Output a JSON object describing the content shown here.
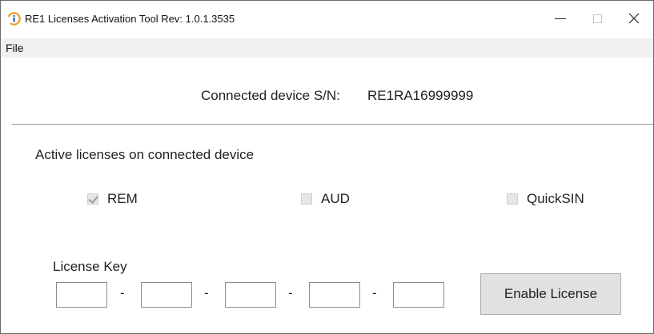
{
  "window": {
    "title": "RE1 Licenses Activation Tool Rev: 1.0.1.3535",
    "controls": {
      "minimize": "—",
      "maximize": "□",
      "close": "✕"
    }
  },
  "menu": {
    "items": [
      "File"
    ]
  },
  "device": {
    "label": "Connected device S/N:",
    "serial": "RE1RA16999999"
  },
  "licenses": {
    "heading": "Active licenses on connected device",
    "items": [
      {
        "label": "REM",
        "checked": true
      },
      {
        "label": "AUD",
        "checked": false
      },
      {
        "label": "QuickSIN",
        "checked": false
      }
    ]
  },
  "license_key": {
    "label": "License Key",
    "segments": [
      "",
      "",
      "",
      "",
      ""
    ],
    "separator": "-"
  },
  "actions": {
    "enable_label": "Enable License"
  },
  "colors": {
    "app_icon_ring": "#f29a1d",
    "app_icon_inner": "#1f5fa8",
    "menubar_bg": "#f0f0f0",
    "button_bg": "#e1e1e1"
  }
}
